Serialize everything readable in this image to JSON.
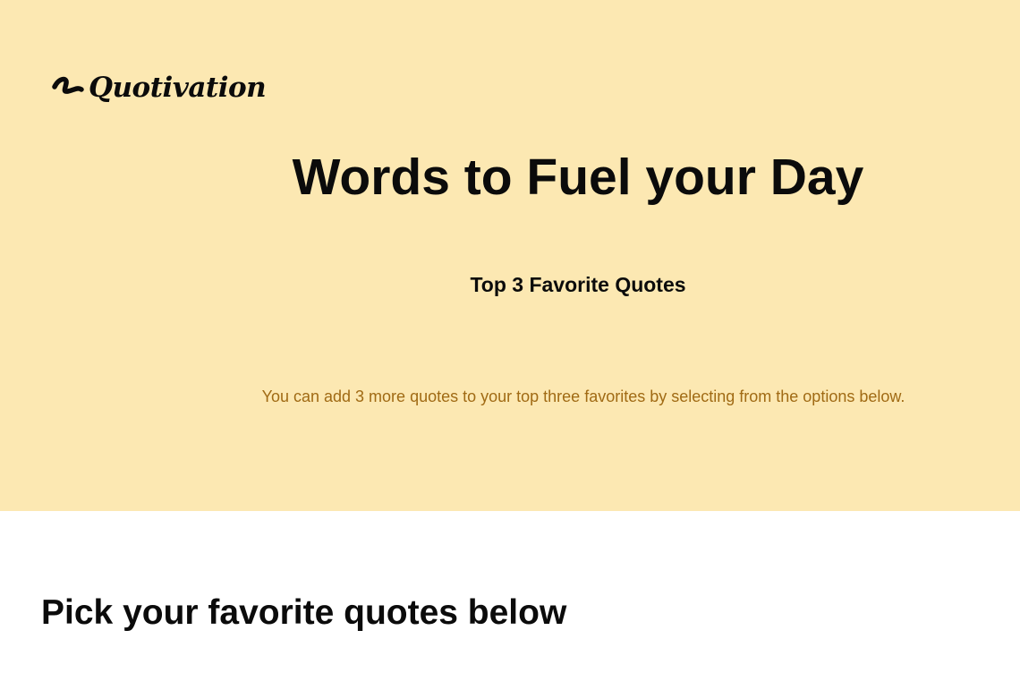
{
  "brand": {
    "name": "Quotivation",
    "logo_icon": "squiggle-logo-icon"
  },
  "hero": {
    "title": "Words to Fuel your Day",
    "subtitle": "Top 3 Favorite Quotes",
    "helper_text": "You can add 3 more quotes to your top three favorites by selecting from the options below.",
    "background_color": "#fce8b2",
    "helper_color": "#a06a14"
  },
  "picker": {
    "title": "Pick your favorite quotes below"
  }
}
